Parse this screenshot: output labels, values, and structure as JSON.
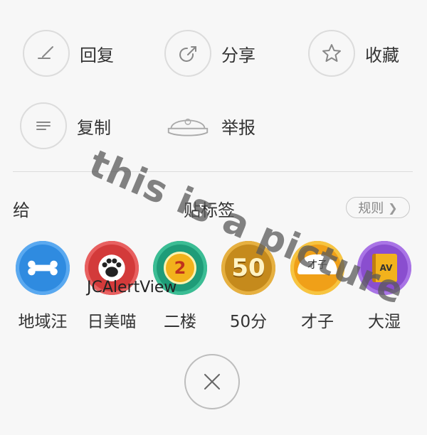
{
  "actions": {
    "reply": "回复",
    "share": "分享",
    "favorite": "收藏",
    "copy": "复制",
    "report": "举报"
  },
  "tag_section": {
    "give": "给",
    "title": "贴标签",
    "rules": "规则"
  },
  "badges": [
    {
      "name": "地域汪",
      "icon": "bone-icon",
      "color": "#2f8be0"
    },
    {
      "name": "日美喵",
      "icon": "paw-icon",
      "color": "#d33a3a"
    },
    {
      "name": "二楼",
      "icon": "number-two-icon",
      "color": "#1f9c78"
    },
    {
      "name": "50分",
      "icon": "fifty-medal-icon",
      "color": "#c58a1c"
    },
    {
      "name": "才子",
      "icon": "folding-fan-icon",
      "color": "#f0a018"
    },
    {
      "name": "大湿",
      "icon": "book-icon",
      "color": "#8a4ecf"
    }
  ],
  "badge_texts": {
    "two": "2",
    "fifty": "50",
    "fan": "才子",
    "book": "AV"
  },
  "watermarks": {
    "big": "this is a picture",
    "small": "JCAlertView"
  }
}
